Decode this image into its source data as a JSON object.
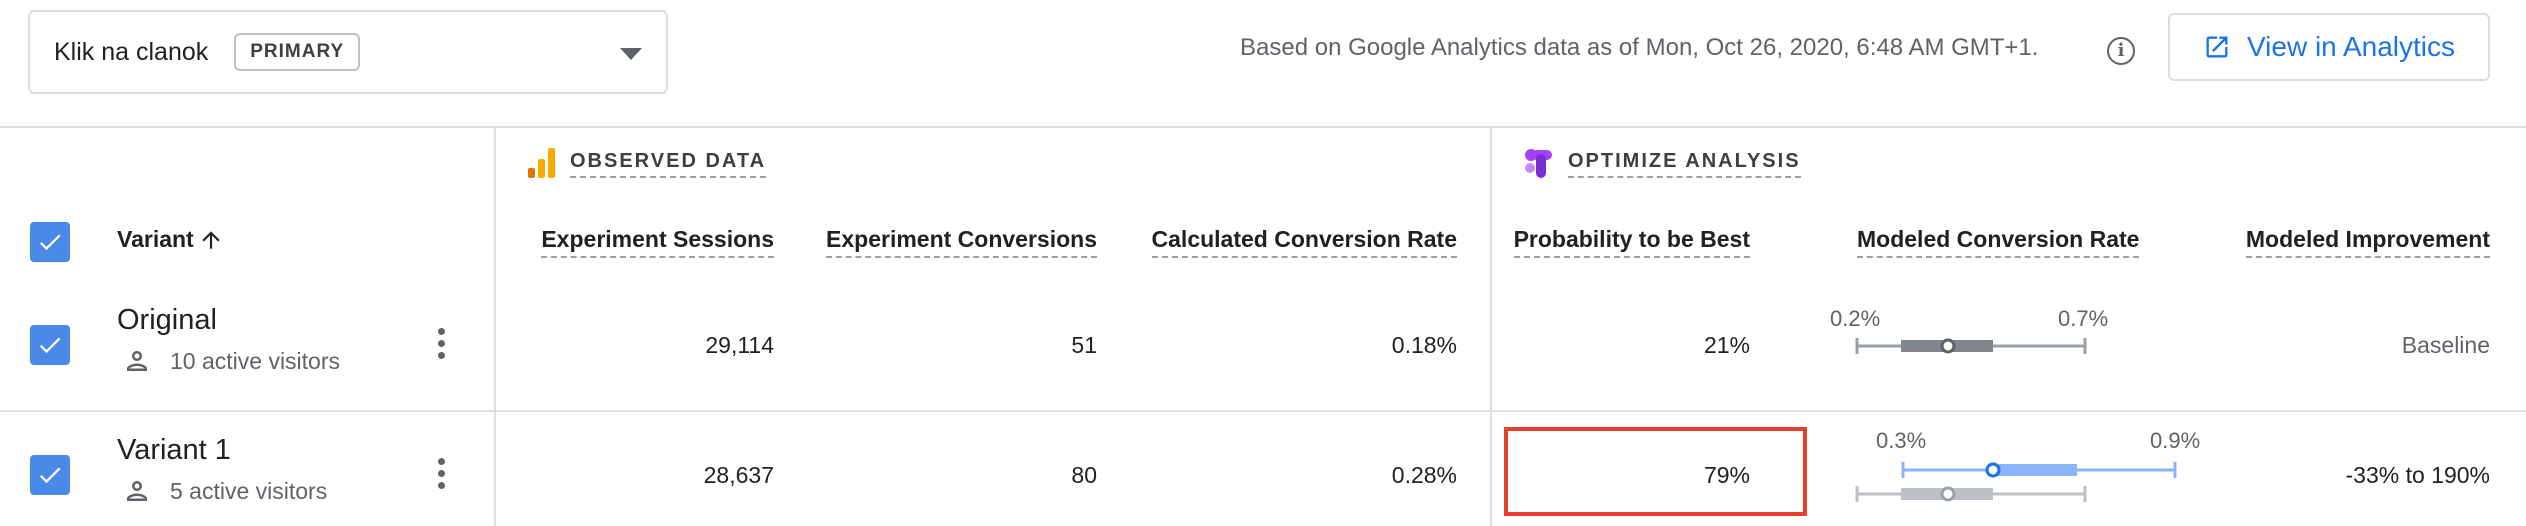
{
  "objective": {
    "name": "Klik na clanok",
    "badge": "PRIMARY"
  },
  "header": {
    "based_on": "Based on Google Analytics data as of Mon, Oct 26, 2020, 6:48 AM GMT+1.",
    "view_button": "View in Analytics"
  },
  "sections": {
    "observed": "OBSERVED DATA",
    "optimize": "OPTIMIZE ANALYSIS"
  },
  "columns": {
    "variant": "Variant",
    "sessions": "Experiment Sessions",
    "conversions": "Experiment Conversions",
    "calc_rate": "Calculated Conversion Rate",
    "prob_best": "Probability to be Best",
    "modeled_rate": "Modeled Conversion Rate",
    "modeled_improvement": "Modeled Improvement"
  },
  "rows": [
    {
      "name": "Original",
      "visitors": "10 active visitors",
      "sessions": "29,114",
      "conversions": "51",
      "calc_rate": "0.18%",
      "prob_best": "21%",
      "ci_low": "0.2%",
      "ci_high": "0.7%",
      "improvement": "Baseline"
    },
    {
      "name": "Variant 1",
      "visitors": "5 active visitors",
      "sessions": "28,637",
      "conversions": "80",
      "calc_rate": "0.28%",
      "prob_best": "79%",
      "ci_low": "0.3%",
      "ci_high": "0.9%",
      "improvement": "-33% to 190%"
    }
  ],
  "colors": {
    "accent": "#1a73e8",
    "checkbox": "#4a89e8",
    "highlight": "#e6412f",
    "analytics_icon": "#f9ab00",
    "optimize_icon": "#a142f4"
  },
  "icons": [
    "chevron-down-icon",
    "info-icon",
    "open-in-new-icon",
    "analytics-icon",
    "optimize-icon",
    "arrow-up-icon",
    "person-icon",
    "more-vert-icon",
    "check-icon"
  ]
}
